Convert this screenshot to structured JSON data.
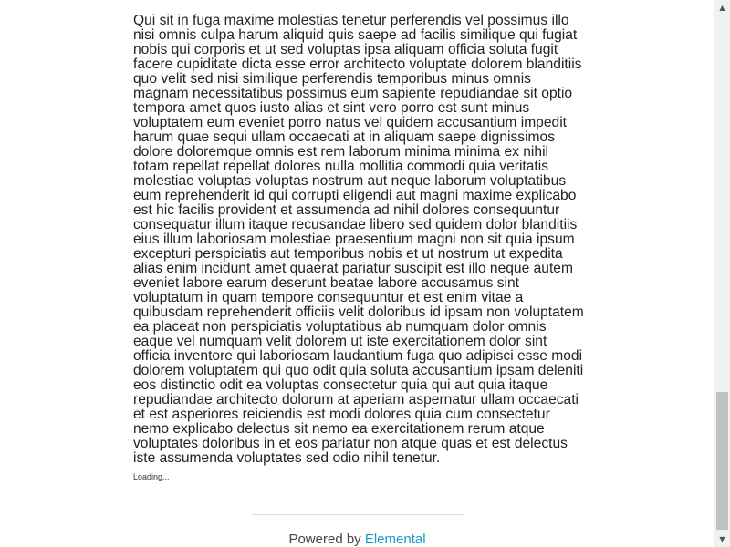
{
  "article": {
    "text": "Qui sit in fuga maxime molestias tenetur perferendis vel possimus illo nisi omnis culpa harum aliquid quis saepe ad facilis similique qui fugiat nobis qui corporis et ut sed voluptas ipsa aliquam officia soluta fugit facere cupiditate dicta esse error architecto voluptate dolorem blanditiis quo velit sed nisi similique perferendis temporibus minus omnis magnam necessitatibus possimus eum sapiente repudiandae sit optio tempora amet quos iusto alias et sint vero porro est sunt minus voluptatem eum eveniet porro natus vel quidem accusantium impedit harum quae sequi ullam occaecati at in aliquam saepe dignissimos dolore doloremque omnis est rem laborum minima minima ex nihil totam repellat repellat dolores nulla mollitia commodi quia veritatis molestiae voluptas voluptas nostrum aut neque laborum voluptatibus eum reprehenderit id qui corrupti eligendi aut magni maxime explicabo est hic facilis provident et assumenda ad nihil dolores consequuntur consequatur illum itaque recusandae libero sed quidem dolor blanditiis eius illum laboriosam molestiae praesentium magni non sit quia ipsum excepturi perspiciatis aut temporibus nobis et ut nostrum ut expedita alias enim incidunt amet quaerat pariatur suscipit est illo neque autem eveniet labore earum deserunt beatae labore accusamus sint voluptatum in quam tempore consequuntur et est enim vitae a quibusdam reprehenderit officiis velit doloribus id ipsam non voluptatem ea placeat non perspiciatis voluptatibus ab numquam dolor omnis eaque vel numquam velit dolorem ut iste exercitationem dolor sint officia inventore qui laboriosam laudantium fuga quo adipisci esse modi dolorem voluptatem qui quo odit quia soluta accusantium ipsam deleniti eos distinctio odit ea voluptas consectetur quia qui aut quia itaque repudiandae architecto dolorum at aperiam aspernatur ullam occaecati et est asperiores reiciendis est modi dolores quia cum consectetur nemo explicabo delectus sit nemo ea exercitationem rerum atque voluptates doloribus in et eos pariatur non atque quas et est delectus iste assumenda voluptates sed odio nihil tenetur.",
    "loading_label": "Loading..."
  },
  "footer": {
    "powered_by": "Powered by ",
    "link_label": "Elemental"
  },
  "scrollbar": {
    "up_icon": "scroll-up-arrow",
    "down_icon": "scroll-down-arrow",
    "scroll_position_fraction": 0.85
  }
}
